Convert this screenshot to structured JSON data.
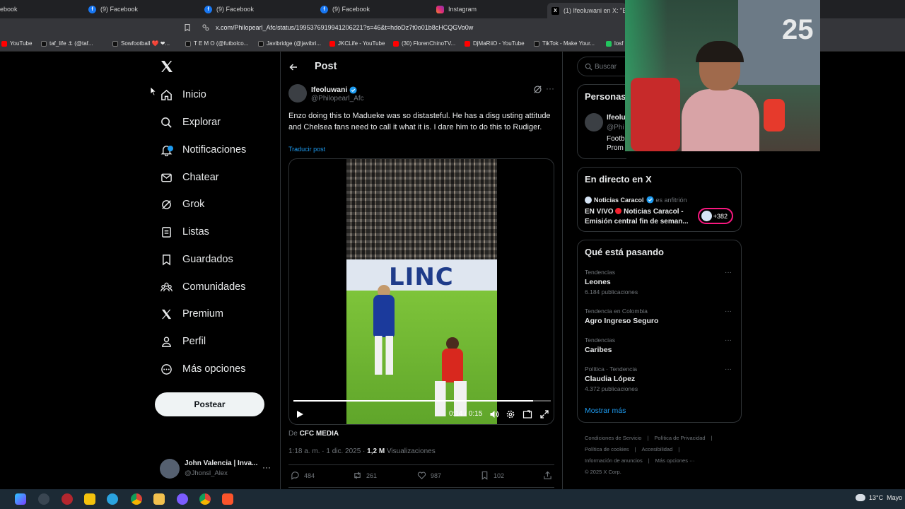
{
  "browser": {
    "tabs": [
      {
        "label": "ebook",
        "icon": "facebook-icon"
      },
      {
        "label": "(9) Facebook",
        "icon": "facebook-icon"
      },
      {
        "label": "(9) Facebook",
        "icon": "facebook-icon"
      },
      {
        "label": "(9) Facebook",
        "icon": "facebook-icon"
      },
      {
        "label": "Instagram",
        "icon": "instagram-icon"
      },
      {
        "label": "(1) Ifeoluwani en X: \"Enz",
        "icon": "x-icon"
      }
    ],
    "url": "x.com/Philopearl_Afc/status/1995376919941206221?s=46&t=hdoDz7t0o01b8cHCQGVo0w",
    "bookmarks": [
      {
        "label": "YouTube",
        "color": "#ff0000"
      },
      {
        "label": "taf_life ⚓ (@taf...",
        "color": "#111111"
      },
      {
        "label": "Sowfootball ❤️ ❤...",
        "color": "#111111"
      },
      {
        "label": "T E M O (@futbolco...",
        "color": "#111111"
      },
      {
        "label": "Javibridge (@javibri...",
        "color": "#111111"
      },
      {
        "label": "JKCLife - YouTube",
        "color": "#ff0000"
      },
      {
        "label": "(30) FlorenChinoTV...",
        "color": "#ff0000"
      },
      {
        "label": "DjMaRiiO - YouTube",
        "color": "#ff0000"
      },
      {
        "label": "TikTok - Make Your...",
        "color": "#111111"
      },
      {
        "label": "losf",
        "color": "#22c55e"
      }
    ]
  },
  "nav": {
    "items": [
      {
        "label": "Inicio",
        "icon": "home-icon"
      },
      {
        "label": "Explorar",
        "icon": "search-icon"
      },
      {
        "label": "Notificaciones",
        "icon": "bell-icon"
      },
      {
        "label": "Chatear",
        "icon": "mail-icon"
      },
      {
        "label": "Grok",
        "icon": "grok-icon"
      },
      {
        "label": "Listas",
        "icon": "list-icon"
      },
      {
        "label": "Guardados",
        "icon": "bookmark-icon"
      },
      {
        "label": "Comunidades",
        "icon": "communities-icon"
      },
      {
        "label": "Premium",
        "icon": "x-premium-icon"
      },
      {
        "label": "Perfil",
        "icon": "person-icon"
      },
      {
        "label": "Más opciones",
        "icon": "more-circle-icon"
      }
    ],
    "post_button": "Postear",
    "user": {
      "name": "John Valencia | Inva...",
      "handle": "@Jhonsl_Alex"
    }
  },
  "post": {
    "header": "Post",
    "author_name": "Ifeoluwani",
    "author_handle": "@Philopearl_Afc",
    "text": "Enzo doing this to Madueke was so distasteful. He has a disg usting attitude and Chelsea fans need to call it what it is. I dare him to do this to Rudiger.",
    "translate": "Traducir post",
    "video": {
      "board_text": "LINC",
      "time": "0:14 / 0:15",
      "progress": 0.93
    },
    "source_prefix": "De",
    "source": "CFC MEDIA",
    "timestamp": "1:18 a. m. · 1 dic. 2025 ·",
    "views_count": "1,2 M",
    "views_label": "Visualizaciones",
    "stats": {
      "replies": "484",
      "reposts": "261",
      "likes": "987",
      "bookmarks": "102"
    }
  },
  "right": {
    "search_placeholder": "Buscar",
    "people": {
      "title": "Personas",
      "name": "Ifeolu",
      "handle": "@Phi",
      "bio_line1": "Footb",
      "bio_line2": "Prom"
    },
    "live": {
      "title": "En directo en X",
      "host": "Noticias Caracol",
      "host_suffix": "es anfitrión",
      "label": "EN VIVO",
      "stream_title": "Noticias Caracol - Emisión central fin de seman...",
      "listeners": "+382"
    },
    "trends": {
      "title": "Qué está pasando",
      "items": [
        {
          "category": "Tendencias",
          "name": "Leones",
          "count": "6.184 publicaciones"
        },
        {
          "category": "Tendencia en Colombia",
          "name": "Agro Ingreso Seguro",
          "count": ""
        },
        {
          "category": "Tendencias",
          "name": "Caribes",
          "count": ""
        },
        {
          "category": "Política · Tendencia",
          "name": "Claudia López",
          "count": "4.372 publicaciones"
        }
      ],
      "show_more": "Mostrar más"
    },
    "footer": {
      "links": [
        "Condiciones de Servicio",
        "|",
        "Política de Privacidad",
        "|",
        "Política de cookies",
        "|",
        "Accesibilidad",
        "|",
        "Información de anuncios",
        "|",
        "Más opciones ···",
        "© 2025 X Corp."
      ]
    }
  },
  "webcam": {
    "jersey_number": "25"
  },
  "taskbar": {
    "weather": "13°C",
    "weather_label": "Mayo"
  }
}
